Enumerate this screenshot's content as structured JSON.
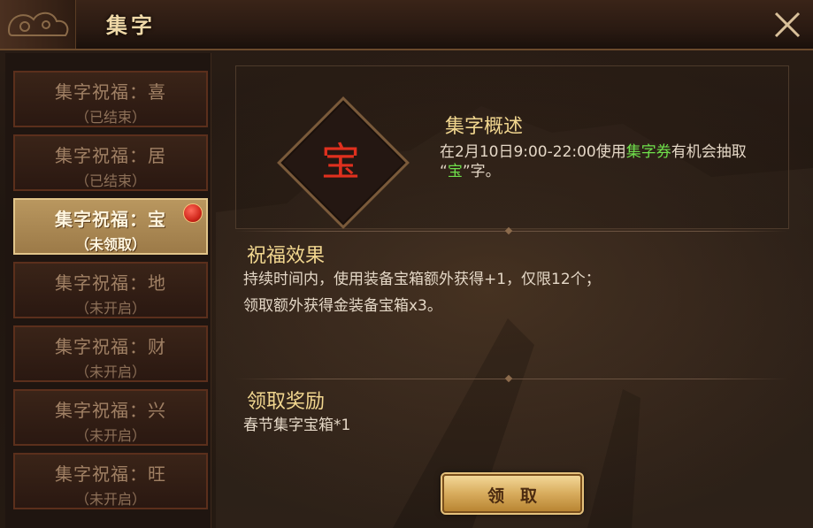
{
  "header": {
    "title": "集字"
  },
  "sidebar": {
    "items": [
      {
        "label": "集字祝福：喜",
        "status": "（已结束）"
      },
      {
        "label": "集字祝福：居",
        "status": "（已结束）"
      },
      {
        "label": "集字祝福：宝",
        "status": "（未领取）",
        "active": true,
        "has_dot": true
      },
      {
        "label": "集字祝福：地",
        "status": "（未开启）"
      },
      {
        "label": "集字祝福：财",
        "status": "（未开启）"
      },
      {
        "label": "集字祝福：兴",
        "status": "（未开启）"
      },
      {
        "label": "集字祝福：旺",
        "status": "（未开启）"
      }
    ]
  },
  "summary": {
    "char": "宝",
    "title": "集字概述",
    "desc_part1": "在2月10日9:00-22:00使用",
    "desc_highlight": "集字券",
    "desc_part2": "有机会抽取",
    "desc_part3_open": "“",
    "desc_highlight2": "宝",
    "desc_part3_close": "”字。"
  },
  "effect": {
    "title": "祝福效果",
    "line1": "持续时间内，使用装备宝箱额外获得+1，仅限12个；",
    "line2": "领取额外获得金装备宝箱x3。"
  },
  "reward": {
    "title": "领取奖励",
    "item": "春节集字宝箱*1"
  },
  "button": {
    "claim_label": "领取"
  },
  "colors": {
    "accent_gold": "#f1d68f",
    "highlight_green": "#6fe04b",
    "char_red": "#e0301e"
  }
}
